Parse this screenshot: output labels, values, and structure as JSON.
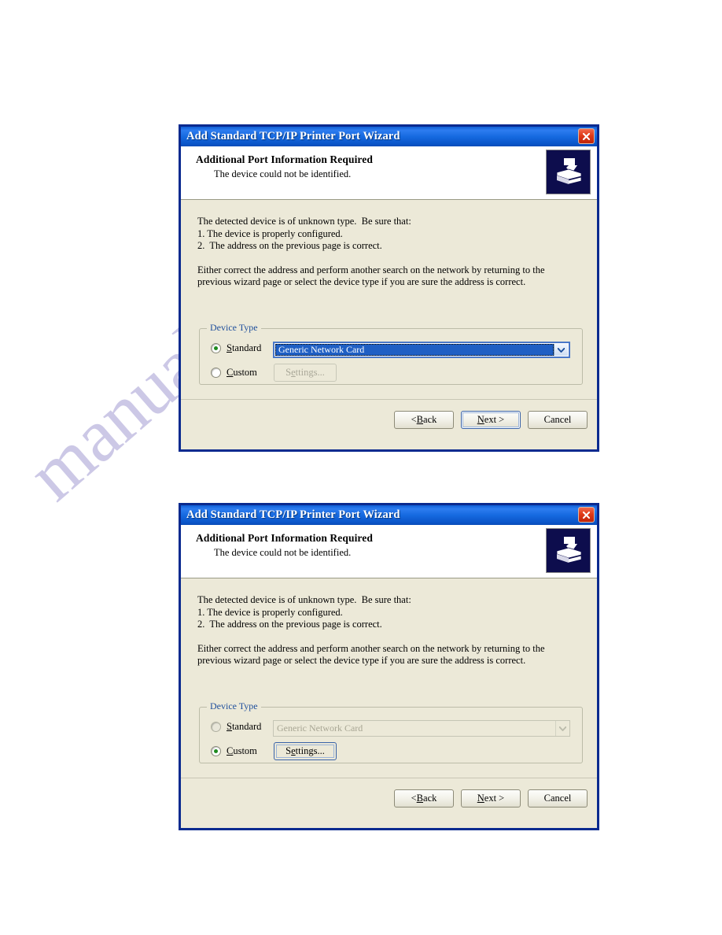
{
  "page": {
    "watermark": "manualshive.com",
    "watermark_color": "#b9b4dd",
    "background": "#ffffff"
  },
  "theme": {
    "titlebar_blue": "#166ae0",
    "dialog_border": "#0a2a8f",
    "body_bg": "#ece9d8",
    "group_label_blue": "#1f4f9c",
    "selection_blue": "#1f5fc4",
    "radio_dot_green": "#1e8a1e",
    "close_red": "#e03a18"
  },
  "dialog1": {
    "title": "Add Standard TCP/IP Printer Port Wizard",
    "close_label": "Close",
    "header": {
      "title": "Additional Port Information Required",
      "subtitle": "The device could not be identified.",
      "icon": "printer-icon"
    },
    "body": {
      "paragraph1": "The detected device is of unknown type.  Be sure that:\n1. The device is properly configured.\n2.  The address on the previous page is correct.",
      "paragraph2": "Either correct the address and perform another search on the network by returning to the\nprevious wizard page or select the device type if you are sure the address is correct."
    },
    "device_type": {
      "group_label": "Device Type",
      "standard": {
        "label": "Standard",
        "accel": "S",
        "selected": true
      },
      "custom": {
        "label": "Custom",
        "accel": "C",
        "selected": false
      },
      "combo": {
        "value": "Generic Network Card",
        "enabled": true,
        "options": [
          "Generic Network Card"
        ]
      },
      "settings_button": {
        "label": "Settings...",
        "accel": "e",
        "enabled": false
      }
    },
    "footer_buttons": [
      {
        "label": "< Back",
        "accel": "B",
        "default": false
      },
      {
        "label": "Next >",
        "accel": "N",
        "default": true
      },
      {
        "label": "Cancel",
        "accel": "",
        "default": false
      }
    ]
  },
  "dialog2": {
    "title": "Add Standard TCP/IP Printer Port Wizard",
    "close_label": "Close",
    "header": {
      "title": "Additional Port Information Required",
      "subtitle": "The device could not be identified.",
      "icon": "printer-icon"
    },
    "body": {
      "paragraph1": "The detected device is of unknown type.  Be sure that:\n1. The device is properly configured.\n2.  The address on the previous page is correct.",
      "paragraph2": "Either correct the address and perform another search on the network by returning to the\nprevious wizard page or select the device type if you are sure the address is correct."
    },
    "device_type": {
      "group_label": "Device Type",
      "standard": {
        "label": "Standard",
        "accel": "S",
        "selected": false
      },
      "custom": {
        "label": "Custom",
        "accel": "C",
        "selected": true
      },
      "combo": {
        "value": "Generic Network Card",
        "enabled": false,
        "options": [
          "Generic Network Card"
        ]
      },
      "settings_button": {
        "label": "Settings...",
        "accel": "e",
        "enabled": true
      }
    },
    "footer_buttons": [
      {
        "label": "< Back",
        "accel": "B",
        "default": false
      },
      {
        "label": "Next >",
        "accel": "N",
        "default": false
      },
      {
        "label": "Cancel",
        "accel": "",
        "default": false
      }
    ]
  }
}
